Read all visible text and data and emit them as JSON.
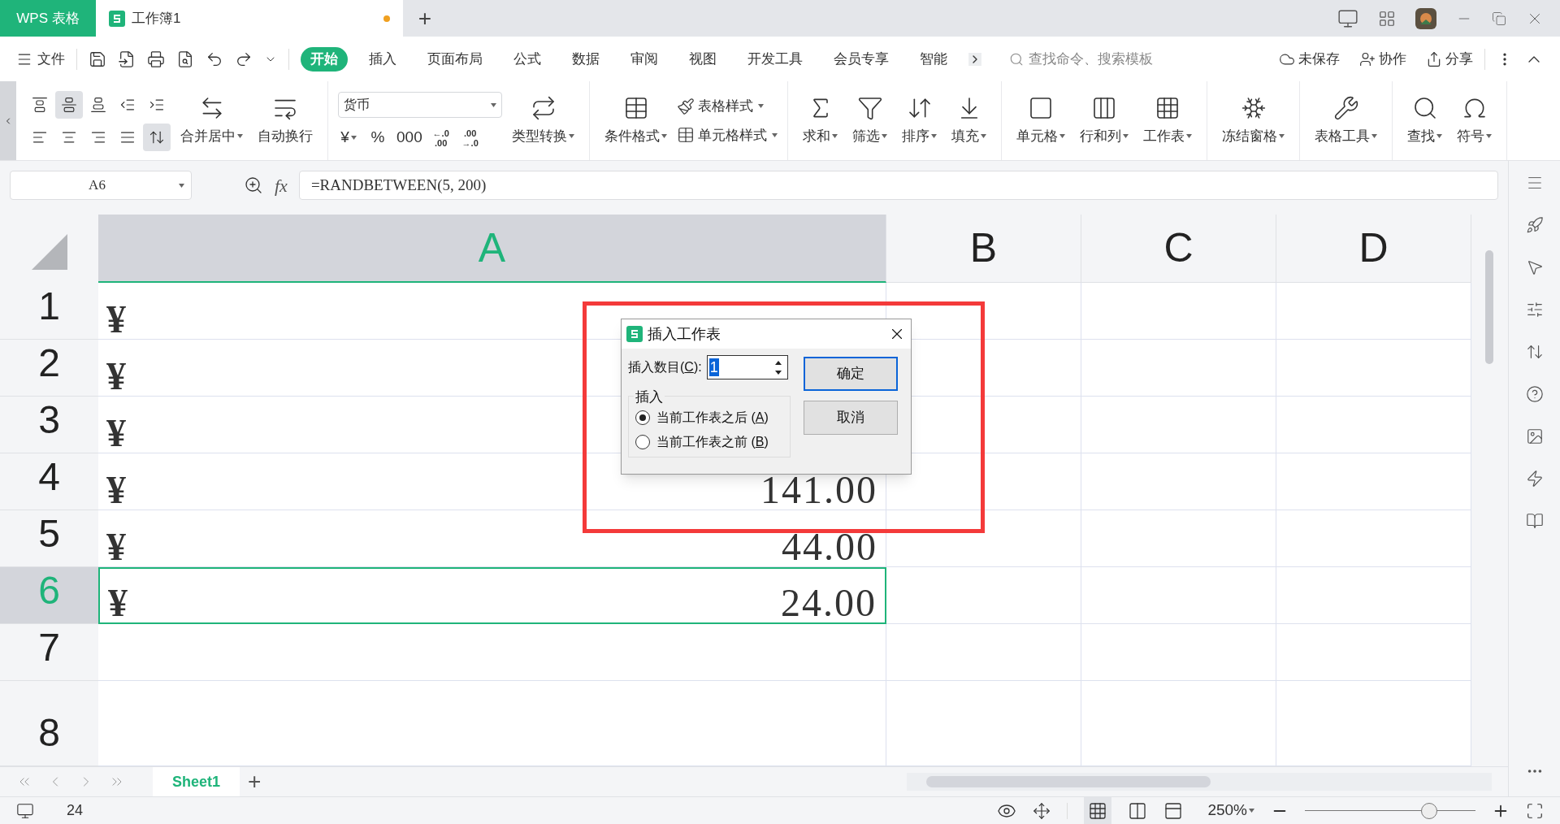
{
  "title_bar": {
    "app_tab": "WPS 表格",
    "doc_tab": {
      "title": "工作簿1",
      "unsaved": true
    },
    "new_tab": "+"
  },
  "menu": {
    "file": "文件",
    "tabs": [
      {
        "label": "开始",
        "selected": true
      },
      {
        "label": "插入",
        "selected": false
      },
      {
        "label": "页面布局",
        "selected": false
      },
      {
        "label": "公式",
        "selected": false
      },
      {
        "label": "数据",
        "selected": false
      },
      {
        "label": "审阅",
        "selected": false
      },
      {
        "label": "视图",
        "selected": false
      },
      {
        "label": "开发工具",
        "selected": false
      },
      {
        "label": "会员专享",
        "selected": false
      },
      {
        "label": "智能",
        "selected": false
      }
    ],
    "search": {
      "placeholder": "查找命令、搜索模板"
    },
    "actions": [
      "未保存",
      "协作",
      "分享"
    ]
  },
  "ribbon": {
    "groups": [
      [
        {
          "kind": "align_grid",
          "buttons": [
            {
              "pressed": false
            },
            {
              "pressed": true
            },
            {
              "pressed": false
            },
            {
              "pressed": false
            },
            {
              "pressed": false
            },
            {
              "pressed": false
            },
            {
              "pressed": false
            },
            {
              "pressed": false
            },
            {
              "pressed": false
            },
            {
              "pressed": true
            }
          ]
        },
        {
          "kind": "large",
          "label": "合并居中",
          "menu": true
        },
        {
          "kind": "large",
          "label": "自动换行",
          "menu": false
        }
      ],
      [
        {
          "kind": "number_format",
          "value": "货币",
          "buttons": [
            {
              "text": "¥",
              "menu": true
            },
            {
              "text": "%",
              "menu": false
            },
            {
              "text": "000",
              "menu": false
            },
            {
              "top": "←.0",
              "bottom": ".00",
              "menu": false
            },
            {
              "top": ".00",
              "bottom": "→.0",
              "menu": false
            }
          ]
        },
        {
          "kind": "large",
          "label": "类型转换",
          "menu": true
        }
      ],
      [
        {
          "kind": "large",
          "label": "条件格式",
          "menu": true
        },
        {
          "kind": "small_stack",
          "items": [
            {
              "label": "表格样式",
              "menu": true
            },
            {
              "label": "单元格样式",
              "menu": true
            }
          ]
        }
      ],
      [
        {
          "kind": "large",
          "label": "求和",
          "menu": true
        },
        {
          "kind": "large",
          "label": "筛选",
          "menu": true
        },
        {
          "kind": "large",
          "label": "排序",
          "menu": true
        },
        {
          "kind": "large",
          "label": "填充",
          "menu": true
        }
      ],
      [
        {
          "kind": "large",
          "label": "单元格",
          "menu": true
        },
        {
          "kind": "large",
          "label": "行和列",
          "menu": true
        },
        {
          "kind": "large",
          "label": "工作表",
          "menu": true
        }
      ],
      [
        {
          "kind": "large",
          "label": "冻结窗格",
          "menu": true
        }
      ],
      [
        {
          "kind": "large",
          "label": "表格工具",
          "menu": true
        }
      ],
      [
        {
          "kind": "large",
          "label": "查找",
          "menu": true
        },
        {
          "kind": "large",
          "label": "符号",
          "menu": true
        }
      ]
    ]
  },
  "formula_bar": {
    "name_box": "A6",
    "fx": "fx",
    "formula": "=RANDBETWEEN(5, 200)"
  },
  "sheet": {
    "columns": [
      {
        "label": "A",
        "selected": true
      },
      {
        "label": "B",
        "selected": false
      },
      {
        "label": "C",
        "selected": false
      },
      {
        "label": "D",
        "selected": false
      }
    ],
    "rows": [
      {
        "label": "1",
        "selected": false,
        "currency": "¥"
      },
      {
        "label": "2",
        "selected": false,
        "currency": "¥"
      },
      {
        "label": "3",
        "selected": false,
        "currency": "¥"
      },
      {
        "label": "4",
        "selected": false,
        "currency": "¥",
        "value": "141.00"
      },
      {
        "label": "5",
        "selected": false,
        "currency": "¥",
        "value": "44.00"
      },
      {
        "label": "6",
        "selected": true,
        "currency": "¥",
        "value": "24.00"
      },
      {
        "label": "7",
        "selected": false
      },
      {
        "label": "8",
        "selected": false
      }
    ]
  },
  "sheet_tabs": {
    "tabs": [
      {
        "label": "Sheet1",
        "selected": true
      }
    ],
    "add": "+"
  },
  "status_bar": {
    "value": "24",
    "zoom": "250%",
    "zoom_slider": {
      "level": 0.73
    }
  },
  "dialog": {
    "title": "插入工作表",
    "count_label": {
      "before": "插入数目(",
      "key": "C",
      "after": "):"
    },
    "count_value": "1",
    "group_label": "插入",
    "options": [
      {
        "before": "当前工作表之后 (",
        "key": "A",
        "after": ")",
        "selected": true
      },
      {
        "before": "当前工作表之前 (",
        "key": "B",
        "after": ")",
        "selected": false
      }
    ],
    "buttons": [
      {
        "label": "确定",
        "default": true
      },
      {
        "label": "取消",
        "default": false
      }
    ]
  }
}
